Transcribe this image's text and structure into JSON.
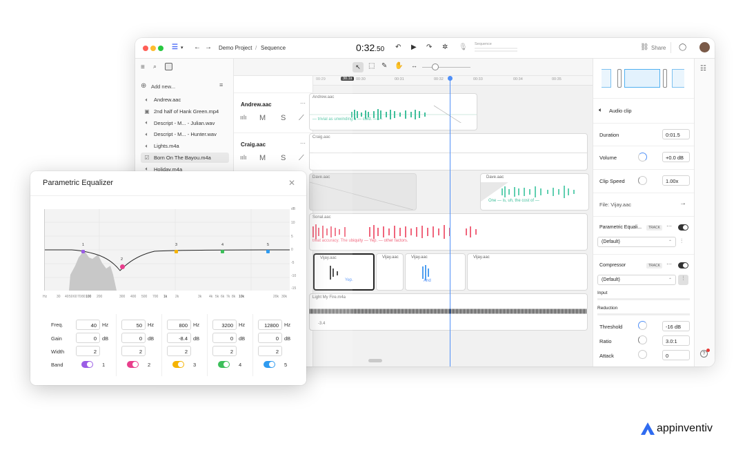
{
  "app": {
    "breadcrumb_project": "Demo Project",
    "breadcrumb_sep": "/",
    "breadcrumb_sequence": "Sequence",
    "timecode_main": "0:32",
    "timecode_frac": ".50",
    "sequence_label": "Sequence",
    "share_label": "Share",
    "colors": {
      "accent": "#4f8ff7",
      "playhead": "#4f8ff7",
      "green": "#3fbf9b",
      "red": "#f0647b"
    }
  },
  "sidebar": {
    "add_new": "Add new...",
    "files": [
      {
        "name": "Andrew.aac",
        "icon": "audio-icon"
      },
      {
        "name": "2nd half of Hank Green.mp4",
        "icon": "video-icon"
      },
      {
        "name": "Descript - M... - Julian.wav",
        "icon": "audio-icon"
      },
      {
        "name": "Descript - M... - Hunter.wav",
        "icon": "audio-icon"
      },
      {
        "name": "Lights.m4a",
        "icon": "audio-icon"
      },
      {
        "name": "Born On The Bayou.m4a",
        "icon": "check-icon"
      },
      {
        "name": "Holiday.m4a",
        "icon": "audio-icon"
      }
    ]
  },
  "tracks": {
    "headers": [
      {
        "name": "Andrew.aac",
        "m": "M",
        "s": "S"
      },
      {
        "name": "Craig.aac",
        "m": "M",
        "s": "S"
      }
    ]
  },
  "timeline": {
    "ruler": [
      "00:29",
      "30.1s",
      "00:30",
      "00:31",
      "00:32",
      "00:33",
      "00:34",
      "00:35"
    ],
    "clips": {
      "andrew": {
        "name": "Andrew.aac",
        "words": "— trivial  as  unwinding  a —  cord.  — —"
      },
      "craig": {
        "name": "Craig.aac"
      },
      "dave_a": {
        "name": "Dave.aac"
      },
      "dave_b": {
        "name": "Dave.aac",
        "words": "One  —  is,  uh,  the  cost  of  —"
      },
      "sonal": {
        "name": "Sonal.aac",
        "words": "treat  accuracy.    The  ubiquity    —    Yep.  —  other    factors."
      },
      "vijay1": {
        "name": "Vijay.aac",
        "words": "Yep."
      },
      "vijay2": {
        "name": "Vijay.aac"
      },
      "vijay3": {
        "name": "Vijay.aac",
        "words": "And"
      },
      "vijay4": {
        "name": "Vijay.aac"
      },
      "fire": {
        "name": "Light My Fire.m4a",
        "gain": "-3.4"
      }
    }
  },
  "inspector": {
    "clip_type": "Audio clip",
    "duration_label": "Duration",
    "duration_value": "0:01.5",
    "volume_label": "Volume",
    "volume_value": "+0.0 dB",
    "speed_label": "Clip Speed",
    "speed_value": "1.00x",
    "file_label": "File: Vijay.aac",
    "eq_label": "Parametric Equali...",
    "eq_tag": "TRACK",
    "eq_preset": "(Default)",
    "comp_label": "Compressor",
    "comp_tag": "TRACK",
    "comp_preset": "(Default)",
    "input_label": "Input",
    "reduction_label": "Reduction",
    "threshold_label": "Threshold",
    "threshold_value": "-16 dB",
    "ratio_label": "Ratio",
    "ratio_value": "3.0:1",
    "attack_label": "Attack",
    "attack_value": "0"
  },
  "eq": {
    "title": "Parametric Equalizer",
    "db_unit": "dB",
    "db_ticks": [
      "10",
      "5",
      "0",
      "-5",
      "-10",
      "-15"
    ],
    "freq_ticks": [
      "Hz",
      "30",
      "40",
      "50",
      "60",
      "70",
      "80",
      "100",
      "200",
      "300",
      "400",
      "500",
      "700",
      "1k",
      "2k",
      "3k",
      "4k",
      "5k",
      "6k",
      "7k",
      "8k",
      "10k",
      "20k",
      "30k"
    ],
    "row_labels": {
      "freq": "Freq.",
      "gain": "Gain",
      "width": "Width",
      "band": "Band"
    },
    "units": {
      "freq": "Hz",
      "gain": "dB"
    },
    "bands": [
      {
        "num": "1",
        "freq": "40",
        "gain": "0",
        "width": "2",
        "color": "#9b5de5"
      },
      {
        "num": "2",
        "freq": "50",
        "gain": "0",
        "width": "2",
        "color": "#e83e8c"
      },
      {
        "num": "3",
        "freq": "800",
        "gain": "-8.4",
        "width": "2",
        "color": "#f5b301"
      },
      {
        "num": "4",
        "freq": "3200",
        "gain": "0",
        "width": "2",
        "color": "#3cbf5a"
      },
      {
        "num": "5",
        "freq": "12800",
        "gain": "0",
        "width": "2",
        "color": "#2f9bf0"
      }
    ]
  },
  "brand": {
    "name": "appinventiv"
  }
}
